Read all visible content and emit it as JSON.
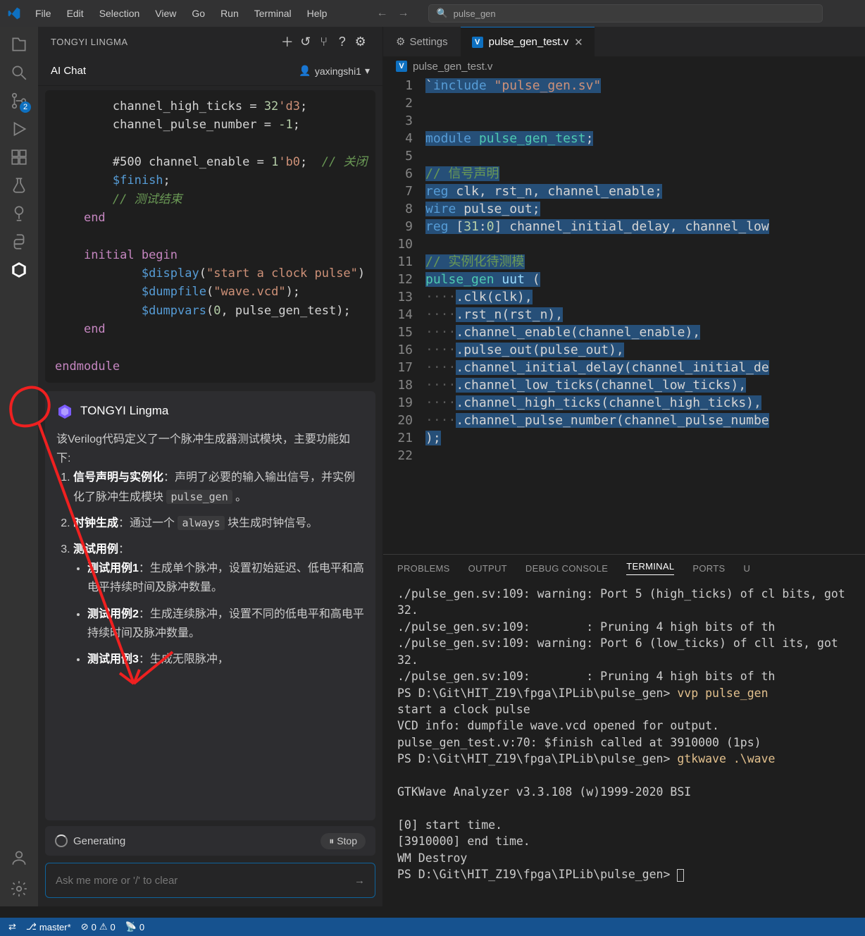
{
  "titlebar": {
    "menus": [
      "File",
      "Edit",
      "Selection",
      "View",
      "Go",
      "Run",
      "Terminal",
      "Help"
    ],
    "search": "pulse_gen"
  },
  "activity": {
    "scm_badge": "2"
  },
  "sidebar": {
    "brand": "TONGYI LINGMA",
    "chat_tab": "AI Chat",
    "user": "yaxingshi1",
    "code": "        channel_high_ticks = 32'd3;\n        channel_pulse_number = -1;\n\n        #500 channel_enable = 1'b0;  // 关闭\n        $finish;\n        // 测试结束\n    end\n\n    initial begin\n            $display(\"start a clock pulse\")\n            $dumpfile(\"wave.vcd\");\n            $dumpvars(0, pulse_gen_test);\n    end\n\nendmodule",
    "resp": {
      "title": "TONGYI Lingma",
      "intro": "该Verilog代码定义了一个脉冲生成器测试模块，主要功能如下:",
      "items": [
        {
          "b": "信号声明与实例化",
          "t1": "：声明了必要的输入输出信号，并实例化了脉冲生成模块 ",
          "code": "pulse_gen",
          "t2": " 。"
        },
        {
          "b": "时钟生成",
          "t1": "：通过一个 ",
          "code": "always",
          "t2": " 块生成时钟信号。"
        },
        {
          "b": "测试用例",
          "t1": "：",
          "sub": [
            {
              "b": "测试用例1",
              "t": "：生成单个脉冲，设置初始延迟、低电平和高电平持续时间及脉冲数量。"
            },
            {
              "b": "测试用例2",
              "t": "：生成连续脉冲，设置不同的低电平和高电平持续时间及脉冲数量。"
            },
            {
              "b": "测试用例3",
              "t": "：生成无限脉冲，"
            }
          ]
        }
      ]
    },
    "generating": "Generating",
    "stop": "Stop",
    "input_ph": "Ask me more or '/' to clear"
  },
  "editor": {
    "tabs": {
      "settings": "Settings",
      "file": "pulse_gen_test.v"
    },
    "breadcrumb": "pulse_gen_test.v",
    "lines": [
      1,
      2,
      3,
      4,
      5,
      6,
      7,
      8,
      9,
      10,
      11,
      12,
      13,
      14,
      15,
      16,
      17,
      18,
      19,
      20,
      21,
      22
    ],
    "code": [
      {
        "pre": "",
        "h": "`<k1>include</k1> <s1>\"pulse_gen.sv\"</s1>"
      },
      {
        "pre": "",
        "h": ""
      },
      {
        "pre": "",
        "h": ""
      },
      {
        "pre": "",
        "h": "<k1>module</k1> <ty>pulse_gen_test</ty>;"
      },
      {
        "pre": "",
        "h": ""
      },
      {
        "pre": "",
        "h": "<c1>// 信号声明</c1>"
      },
      {
        "pre": "",
        "h": "<k1>reg</k1> clk, rst_n, channel_enable;"
      },
      {
        "pre": "",
        "h": "<k1>wire</k1> pulse_out;"
      },
      {
        "pre": "",
        "h": "<k1>reg</k1> [<nn>31</nn>:<nn>0</nn>] channel_initial_delay, channel_low"
      },
      {
        "pre": "",
        "h": ""
      },
      {
        "pre": "",
        "h": "<c1>// 实例化待测模</c1>"
      },
      {
        "pre": "",
        "h": "<ty>pulse_gen</ty> <pn>uut</pn> ("
      },
      {
        "pre": "<ws>····</ws>",
        "h": ".clk(clk),"
      },
      {
        "pre": "<ws>····</ws>",
        "h": ".rst_n(rst_n),"
      },
      {
        "pre": "<ws>····</ws>",
        "h": ".channel_enable(channel_enable),"
      },
      {
        "pre": "<ws>····</ws>",
        "h": ".pulse_out(pulse_out),"
      },
      {
        "pre": "<ws>····</ws>",
        "h": ".channel_initial_delay(channel_initial_de"
      },
      {
        "pre": "<ws>····</ws>",
        "h": ".channel_low_ticks(channel_low_ticks),"
      },
      {
        "pre": "<ws>····</ws>",
        "h": ".channel_high_ticks(channel_high_ticks),"
      },
      {
        "pre": "<ws>····</ws>",
        "h": ".channel_pulse_number(channel_pulse_numbe"
      },
      {
        "pre": "",
        "h": ");"
      },
      {
        "pre": "",
        "h": ""
      }
    ]
  },
  "panel": {
    "tabs": [
      "PROBLEMS",
      "OUTPUT",
      "DEBUG CONSOLE",
      "TERMINAL",
      "PORTS",
      "U"
    ],
    "active": 3,
    "term": "./pulse_gen.sv:109: warning: Port 5 (high_ticks) of cl bits, got 32.\n./pulse_gen.sv:109:        : Pruning 4 high bits of th\n./pulse_gen.sv:109: warning: Port 6 (low_ticks) of cll its, got 32.\n./pulse_gen.sv:109:        : Pruning 4 high bits of th\nPS D:\\Git\\HIT_Z19\\fpga\\IPLib\\pulse_gen> <cmd>vvp pulse_gen</cmd>\nstart a clock pulse\nVCD info: dumpfile wave.vcd opened for output.\npulse_gen_test.v:70: $finish called at 3910000 (1ps)\nPS D:\\Git\\HIT_Z19\\fpga\\IPLib\\pulse_gen> <cmd>gtkwave .\\wave</cmd>\n\nGTKWave Analyzer v3.3.108 (w)1999-2020 BSI\n\n[0] start time.\n[3910000] end time.\nWM Destroy\nPS D:\\Git\\HIT_Z19\\fpga\\IPLib\\pulse_gen> "
  },
  "status": {
    "remote": "",
    "branch": "master*",
    "err": "0",
    "warn": "0",
    "radio": "0"
  }
}
